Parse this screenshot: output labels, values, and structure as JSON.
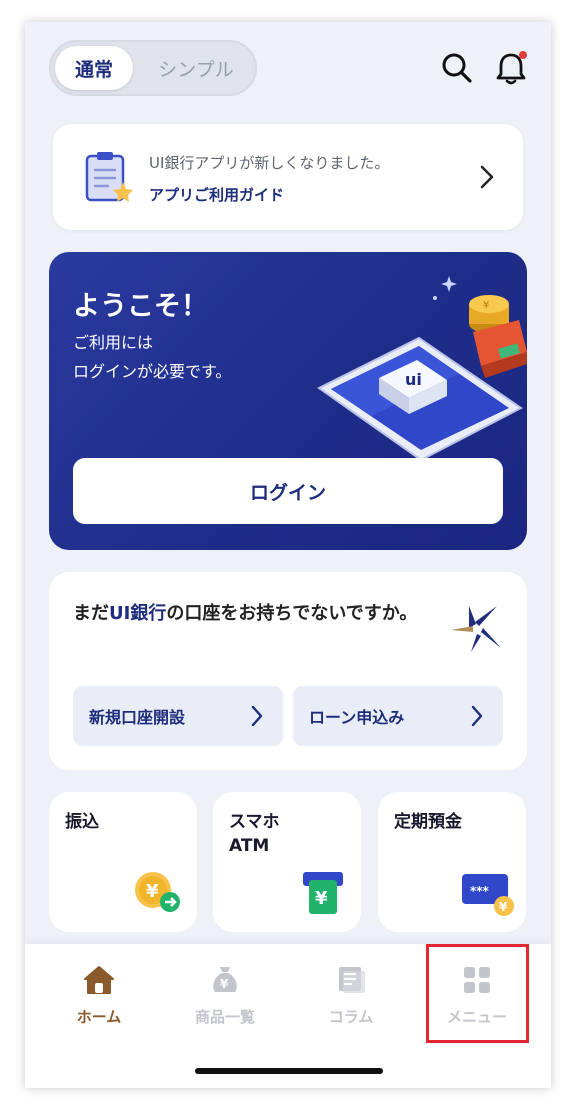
{
  "header": {
    "mode_normal": "通常",
    "mode_simple": "シンプル",
    "search_icon": "search-icon",
    "bell_icon": "bell-icon"
  },
  "guide": {
    "title": "UI銀行アプリが新しくなりました。",
    "link": "アプリご利用ガイド"
  },
  "welcome": {
    "title": "ようこそ！",
    "subtitle": "ご利用には\nログインが必要です。",
    "login_label": "ログイン",
    "brand_color": "#1f2d8a"
  },
  "account": {
    "text_prefix": "まだ",
    "text_brand": "UI銀行",
    "text_suffix": "の口座をお持ちでないですか。",
    "open_account_label": "新規口座開設",
    "loan_label": "ローン申込み"
  },
  "tiles": [
    {
      "label": "振込"
    },
    {
      "label": "スマホ\nATM"
    },
    {
      "label": "定期預金"
    }
  ],
  "tabbar": {
    "tabs": [
      {
        "label": "ホーム",
        "active": true
      },
      {
        "label": "商品一覧",
        "active": false
      },
      {
        "label": "コラム",
        "active": false
      },
      {
        "label": "メニュー",
        "active": false
      }
    ],
    "active_color": "#8a5a2b",
    "inactive_color": "#c2c5cc"
  },
  "highlight_color": "#e0282e"
}
